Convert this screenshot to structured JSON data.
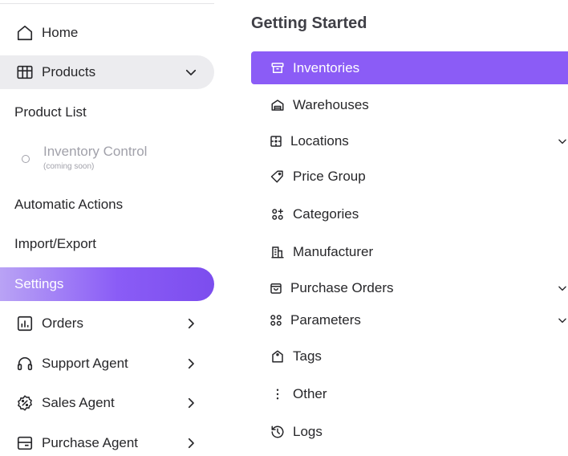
{
  "sidebar": {
    "home": {
      "label": "Home",
      "icon": "home-icon"
    },
    "products": {
      "label": "Products",
      "icon": "products-icon"
    },
    "product_list": {
      "label": "Product List"
    },
    "inventory_control": {
      "label": "Inventory Control",
      "note": "(coming soon)"
    },
    "automatic_actions": {
      "label": "Automatic Actions"
    },
    "import_export": {
      "label": "Import/Export"
    },
    "settings": {
      "label": "Settings"
    },
    "orders": {
      "label": "Orders",
      "icon": "chart-icon"
    },
    "support_agent": {
      "label": "Support Agent",
      "icon": "headset-icon"
    },
    "sales_agent": {
      "label": "Sales Agent",
      "icon": "discount-badge-icon"
    },
    "purchase_agent": {
      "label": "Purchase Agent",
      "icon": "card-icon"
    }
  },
  "panel": {
    "title": "Getting Started",
    "items": [
      {
        "label": "Inventories",
        "icon": "archive-icon",
        "active": true
      },
      {
        "label": "Warehouses",
        "icon": "warehouse-icon"
      },
      {
        "label": "Locations",
        "icon": "locations-icon",
        "expandable": true
      },
      {
        "label": "Price Group",
        "icon": "tag-icon"
      },
      {
        "label": "Categories",
        "icon": "categories-icon"
      },
      {
        "label": "Manufacturer",
        "icon": "building-icon"
      },
      {
        "label": "Purchase Orders",
        "icon": "shopping-bag-icon",
        "expandable": true
      },
      {
        "label": "Parameters",
        "icon": "parameters-icon",
        "expandable": true
      },
      {
        "label": "Tags",
        "icon": "tag-label-icon"
      },
      {
        "label": "Other",
        "icon": "more-vertical-icon"
      },
      {
        "label": "Logs",
        "icon": "history-icon"
      }
    ]
  },
  "colors": {
    "accent": "#8b5cf6",
    "active_bg_light": "#ececef",
    "text": "#27272a",
    "muted": "#a1a1aa"
  }
}
